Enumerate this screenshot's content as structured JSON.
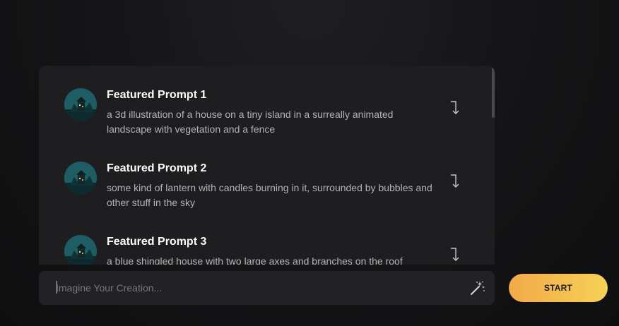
{
  "prompts": [
    {
      "title": "Featured Prompt 1",
      "description": "a 3d illustration of a house on a tiny island in a surreally animated landscape with vegetation and a fence",
      "icon": "use-prompt-arrow-icon"
    },
    {
      "title": "Featured Prompt 2",
      "description": "some kind of lantern with candles burning in it, surrounded by bubbles and other stuff in the sky",
      "icon": "use-prompt-arrow-icon"
    },
    {
      "title": "Featured Prompt 3",
      "description": "a blue shingled house with two large axes and branches on the roof",
      "icon": "use-prompt-arrow-icon"
    }
  ],
  "input": {
    "placeholder": "Imagine Your Creation...",
    "value": ""
  },
  "start_button": {
    "label": "START"
  },
  "icons": {
    "wand": "magic-wand-icon",
    "avatar": "prompt-thumbnail"
  },
  "colors": {
    "accent_start": "#f2a94a",
    "accent_end": "#f6d154",
    "panel": "#1e1e21",
    "text_muted": "#b3b3b7"
  }
}
